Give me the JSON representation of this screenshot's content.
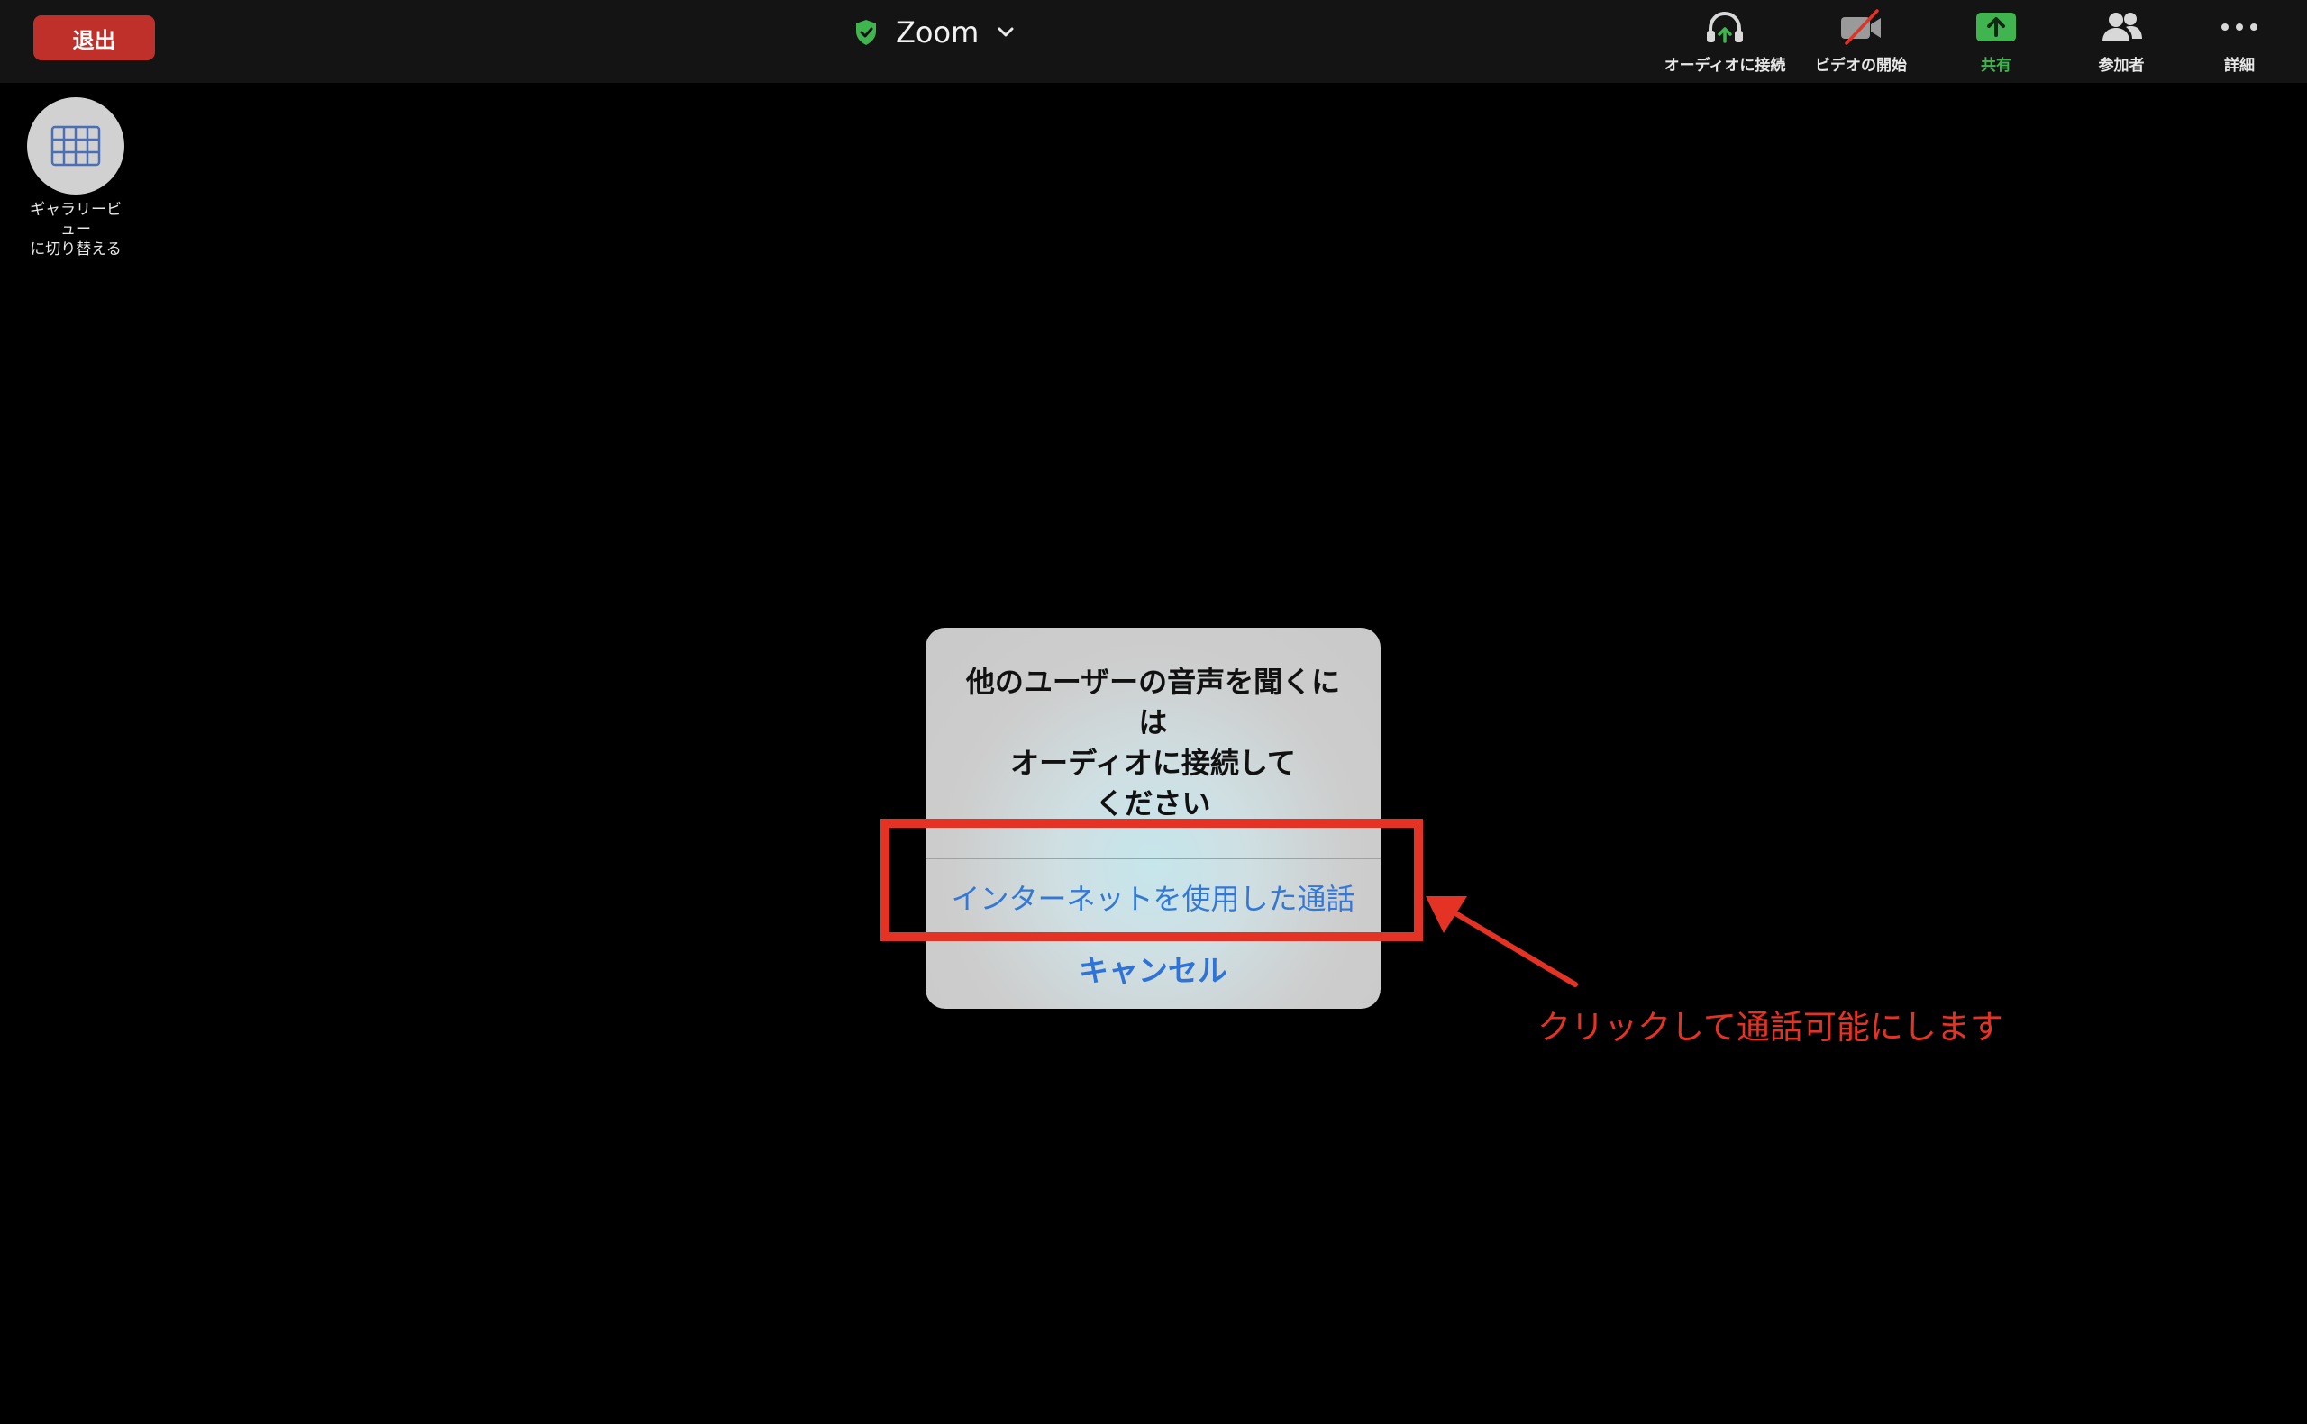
{
  "topbar": {
    "leave_label": "退出",
    "title": "Zoom",
    "items": [
      {
        "label": "オーディオに接続",
        "icon": "headphones-icon"
      },
      {
        "label": "ビデオの開始",
        "icon": "video-off-icon"
      },
      {
        "label": "共有",
        "icon": "share-screen-icon"
      },
      {
        "label": "参加者",
        "icon": "participants-icon"
      },
      {
        "label": "詳細",
        "icon": "more-icon"
      }
    ],
    "colors": {
      "leave_button": "#c0302b",
      "share_accent": "#40b44f",
      "shield": "#40b44f"
    }
  },
  "gallery": {
    "label_line1": "ギャラリービ",
    "label_line2": "ュー",
    "label_line3": "に切り替える",
    "icon": "grid-icon"
  },
  "dialog": {
    "message_line1": "他のユーザーの音声を聞くに",
    "message_line2": "は",
    "message_line3": "オーディオに接続して",
    "message_line4": "ください",
    "option_label": "インターネットを使用した通話",
    "cancel_label": "キャンセル",
    "link_color": "#3478d6"
  },
  "annotation": {
    "text": "クリックして通話可能にします",
    "color": "#e43325"
  }
}
